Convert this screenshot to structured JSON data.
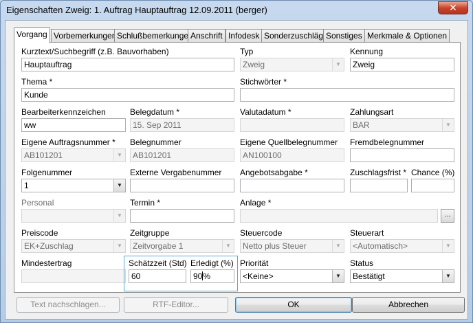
{
  "window": {
    "title": "Eigenschaften Zweig: 1. Auftrag Hauptauftrag 12.09.2011 (berger)",
    "close_glyph": "✕"
  },
  "tabs": [
    "Vorgang",
    "Vorbemerkungen",
    "Schlußbemerkungen",
    "Anschrift",
    "Infodesk",
    "Sonderzuschläge",
    "Sonstiges",
    "Merkmale & Optionen"
  ],
  "form": {
    "kurztext_label": "Kurztext/Suchbegriff (z.B. Bauvorhaben)",
    "kurztext_value": "Hauptauftrag",
    "typ_label": "Typ",
    "typ_value": "Zweig",
    "kennung_label": "Kennung",
    "kennung_value": "Zweig",
    "thema_label": "Thema *",
    "thema_value": "Kunde",
    "stichwoerter_label": "Stichwörter *",
    "stichwoerter_value": "",
    "bearbeiter_label": "Bearbeiterkennzeichen",
    "bearbeiter_value": "ww",
    "belegdatum_label": "Belegdatum *",
    "belegdatum_value": "15. Sep 2011",
    "valutadatum_label": "Valutadatum *",
    "valutadatum_value": "",
    "zahlungsart_label": "Zahlungsart",
    "zahlungsart_value": "BAR",
    "eigene_auftragsnr_label": "Eigene Auftragsnummer *",
    "eigene_auftragsnr_value": "AB101201",
    "belegnummer_label": "Belegnummer",
    "belegnummer_value": "AB101201",
    "quellbelegnr_label": "Eigene Quellbelegnummer",
    "quellbelegnr_value": "AN100100",
    "fremdbelegnr_label": "Fremdbelegnummer",
    "fremdbelegnr_value": "",
    "folgenummer_label": "Folgenummer",
    "folgenummer_value": "1",
    "externe_vergabe_label": "Externe Vergabenummer",
    "externe_vergabe_value": "",
    "angebotsabgabe_label": "Angebotsabgabe *",
    "angebotsabgabe_value": "",
    "zuschlagsfrist_label": "Zuschlagsfrist *",
    "zuschlagsfrist_value": "",
    "chance_label": "Chance (%)",
    "chance_value": "",
    "personal_label": "Personal",
    "personal_value": "",
    "termin_label": "Termin *",
    "termin_value": "",
    "anlage_label": "Anlage *",
    "anlage_value": "",
    "anlage_button": "...",
    "preiscode_label": "Preiscode",
    "preiscode_value": "EK+Zuschlag",
    "zeitgruppe_label": "Zeitgruppe",
    "zeitgruppe_value": "Zeitvorgabe 1",
    "steuercode_label": "Steuercode",
    "steuercode_value": "Netto plus Steuer",
    "steuerart_label": "Steuerart",
    "steuerart_value": "<Automatisch>",
    "mindestertrag_label": "Mindestertrag",
    "mindestertrag_value": "",
    "schaetzzeit_label": "Schätzzeit (Std)",
    "schaetzzeit_value": "60",
    "erledigt_label": "Erledigt (%)",
    "erledigt_value_a": "90",
    "erledigt_value_b": "%",
    "prioritaet_label": "Priorität",
    "prioritaet_value": "<Keine>",
    "status_label": "Status",
    "status_value": "Bestätigt"
  },
  "buttons": {
    "text_nachschlagen": "Text nachschlagen...",
    "rtf_editor": "RTF-Editor...",
    "ok": "OK",
    "abbrechen": "Abbrechen"
  },
  "icons": {
    "dropdown_arrow": "▼"
  }
}
